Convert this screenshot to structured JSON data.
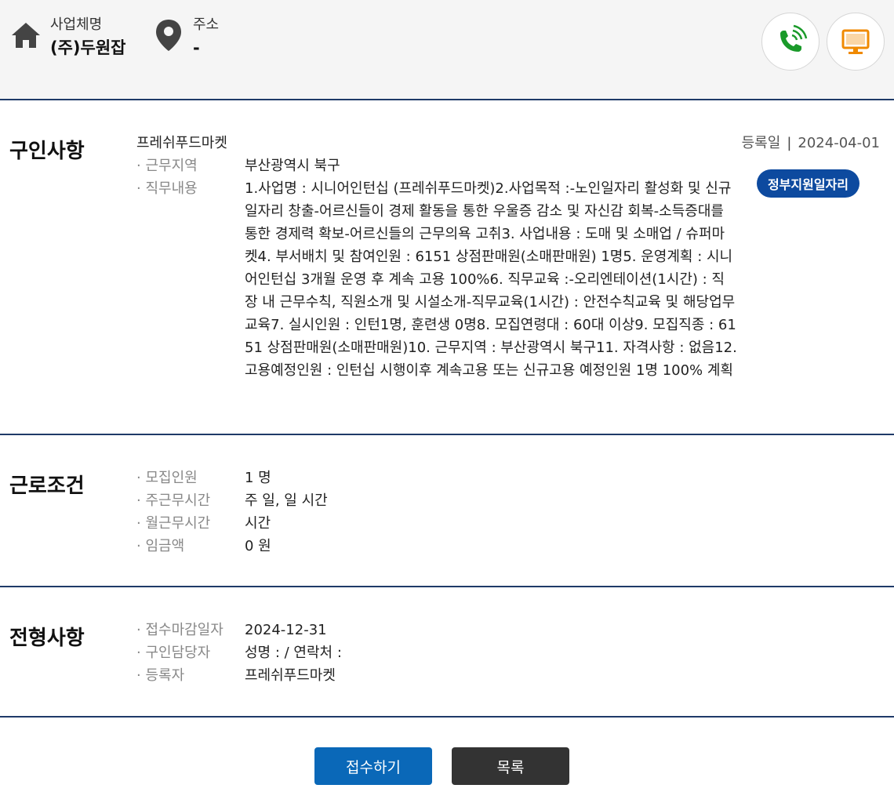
{
  "header": {
    "company_label": "사업체명",
    "company_name": "(주)두원잡",
    "address_label": "주소",
    "address_value": "-",
    "icons": {
      "home": "home-icon",
      "location": "location-pin-icon",
      "phone": "phone-call-icon",
      "web": "monitor-icon"
    },
    "colors": {
      "phone": "#1a9a2a",
      "web": "#f08a00"
    }
  },
  "recruit": {
    "title": "구인사항",
    "job_title": "프레쉬푸드마켓",
    "reg_label": "등록일",
    "reg_sep": "|",
    "reg_date": "2024-04-01",
    "badge": "정부지원일자리",
    "rows": [
      {
        "k": "· 근무지역",
        "v": "부산광역시 북구"
      },
      {
        "k": "· 직무내용",
        "v": "1.사업명 : 시니어인턴십 (프레쉬푸드마켓)2.사업목적 :-노인일자리 활성화 및 신규 일자리 창출-어르신들이 경제 활동을 통한 우울증 감소 및 자신감 회복-소득증대를 통한 경제력 확보-어르신들의 근무의욕 고취3. 사업내용 : 도매 및 소매업 / 슈퍼마켓4. 부서배치 및 참여인원 : 6151 상점판매원(소매판매원) 1명5. 운영계획 : 시니어인턴십 3개월 운영 후 계속 고용 100%6. 직무교육 :-오리엔테이션(1시간) : 직장 내 근무수칙, 직원소개 및 시설소개-직무교육(1시간) : 안전수칙교육 및 해당업무교육7. 실시인원 : 인턴1명, 훈련생 0명8. 모집연령대 : 60대 이상9. 모집직종 : 6151 상점판매원(소매판매원)10. 근무지역 : 부산광역시 북구11. 자격사항 : 없음12. 고용예정인원 : 인턴십 시행이후 계속고용 또는 신규고용 예정인원 1명 100% 계획"
      }
    ]
  },
  "conditions": {
    "title": "근로조건",
    "rows": [
      {
        "k": "· 모집인원",
        "v": "1 명"
      },
      {
        "k": "· 주근무시간",
        "v": "주 일, 일 시간"
      },
      {
        "k": "· 월근무시간",
        "v": "시간"
      },
      {
        "k": "· 임금액",
        "v": "0 원"
      }
    ]
  },
  "screening": {
    "title": "전형사항",
    "rows": [
      {
        "k": "· 접수마감일자",
        "v": "2024-12-31"
      },
      {
        "k": "· 구인담당자",
        "v": "성명 : / 연락처 :"
      },
      {
        "k": "· 등록자",
        "v": "프레쉬푸드마켓"
      }
    ]
  },
  "buttons": {
    "apply": "접수하기",
    "list": "목록",
    "apply_color": "#0a68b8",
    "list_color": "#333333"
  }
}
